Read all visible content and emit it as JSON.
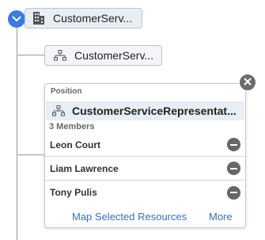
{
  "tree": {
    "root": {
      "label": "CustomerServ...",
      "icon": "building-icon"
    },
    "child": {
      "label": "CustomerServ...",
      "icon": "org-chart-icon"
    }
  },
  "card": {
    "type_label": "Position",
    "title": "CustomerServiceRepresentat...",
    "title_icon": "org-chart-icon",
    "members_count": "3 Members",
    "members": [
      {
        "name": "Leon Court"
      },
      {
        "name": "Liam Lawrence"
      },
      {
        "name": "Tony Pulis"
      }
    ],
    "map_link": "Map Selected Resources",
    "more_link": "More"
  },
  "colors": {
    "accent": "#3a7be0",
    "link": "#3a6fc0",
    "node_bg": "#e9edf4"
  }
}
